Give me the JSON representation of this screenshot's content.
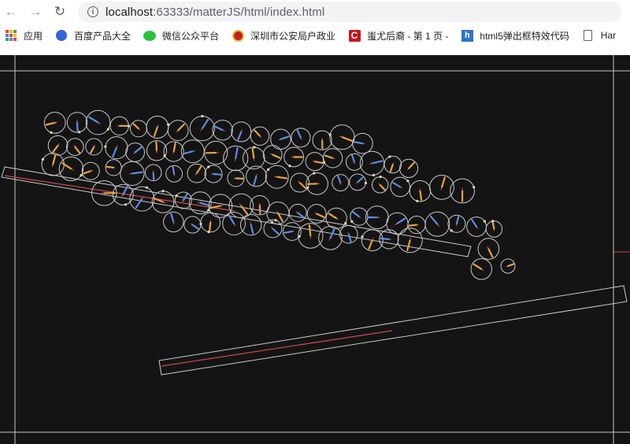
{
  "browser": {
    "url_host": "localhost",
    "url_rest": ":63333/matterJS/html/index.html",
    "back_icon": "arrow-left-icon",
    "forward_icon": "arrow-right-icon",
    "reload_icon": "reload-icon",
    "info_icon": "info-icon"
  },
  "bookmarks": [
    {
      "label": "应用",
      "icon": "apps-grid-icon"
    },
    {
      "label": "百度产品大全",
      "icon": "baidu-paw-icon"
    },
    {
      "label": "微信公众平台",
      "icon": "wechat-icon"
    },
    {
      "label": "深圳市公安局户政业",
      "icon": "police-badge-icon"
    },
    {
      "label": "蚩尤后裔 - 第 1 页 -",
      "icon": "red-c-icon"
    },
    {
      "label": "html5弹出框特效代码",
      "icon": "h5-icon"
    },
    {
      "label": "Har",
      "icon": "document-icon"
    }
  ],
  "colors": {
    "canvas_bg": "#141414",
    "wire": "#c8c8c8",
    "accent_red": "#ce4a4a",
    "marker_orange": "#e8a33c",
    "marker_blue": "#5b8ee8",
    "contact_point": "#e8d9a8"
  }
}
